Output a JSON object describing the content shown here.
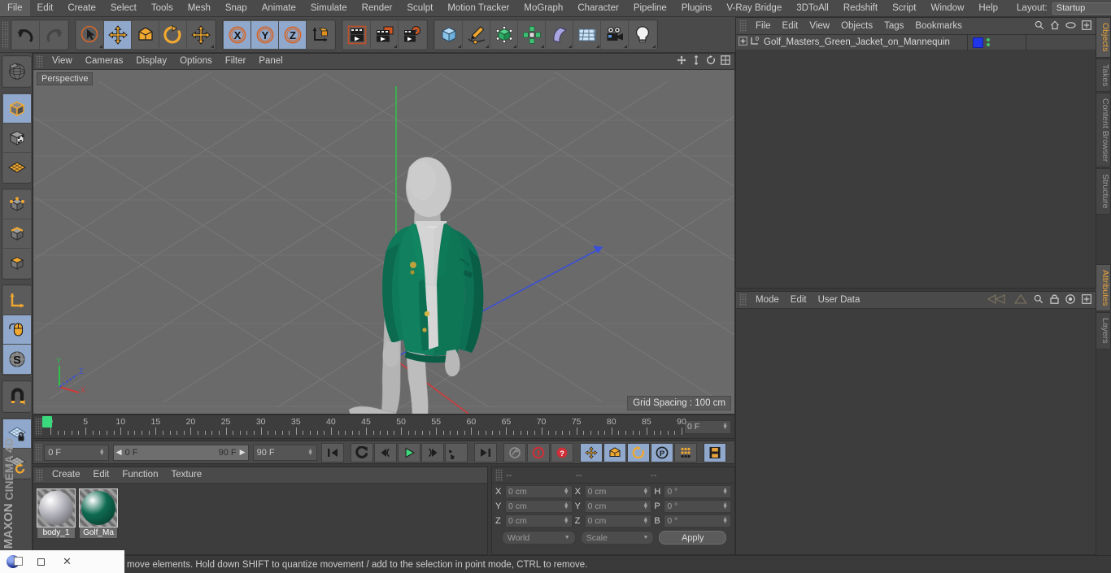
{
  "menubar": {
    "items": [
      "File",
      "Edit",
      "Create",
      "Select",
      "Tools",
      "Mesh",
      "Snap",
      "Animate",
      "Simulate",
      "Render",
      "Sculpt",
      "Motion Tracker",
      "MoGraph",
      "Character",
      "Pipeline",
      "Plugins",
      "V-Ray Bridge",
      "3DToAll",
      "Redshift",
      "Script",
      "Window",
      "Help"
    ],
    "layout_label": "Layout:",
    "layout_value": "Startup",
    "search_icon": "search-icon"
  },
  "toolbar": {
    "groups": [
      {
        "name": "history",
        "buttons": [
          {
            "name": "undo-button",
            "icon": "undo-icon",
            "active": false
          },
          {
            "name": "redo-button",
            "icon": "redo-icon",
            "active": false
          }
        ]
      },
      {
        "name": "transform-tools",
        "buttons": [
          {
            "name": "live-selection-tool",
            "icon": "cursor-circle-icon",
            "active": false
          },
          {
            "name": "move-tool",
            "icon": "move-arrows-icon",
            "active": true
          },
          {
            "name": "scale-tool",
            "icon": "scale-box-icon",
            "active": false
          },
          {
            "name": "rotate-tool",
            "icon": "rotate-arc-icon",
            "active": false
          },
          {
            "name": "transform-tool",
            "icon": "move-arrows-icon",
            "active": false
          }
        ]
      },
      {
        "name": "axis-locks",
        "buttons": [
          {
            "name": "lock-x-axis-button",
            "icon": "x-axis-icon",
            "active": true
          },
          {
            "name": "lock-y-axis-button",
            "icon": "y-axis-icon",
            "active": true
          },
          {
            "name": "lock-z-axis-button",
            "icon": "z-axis-icon",
            "active": true
          },
          {
            "name": "world-object-coord-button",
            "icon": "world-axis-icon",
            "active": false
          }
        ]
      },
      {
        "name": "render-tools",
        "buttons": [
          {
            "name": "render-view-button",
            "icon": "render-view-icon",
            "active": false
          },
          {
            "name": "render-to-picture-viewer-button",
            "icon": "render-picture-icon",
            "active": false
          },
          {
            "name": "render-settings-button",
            "icon": "render-settings-icon",
            "active": false
          }
        ]
      },
      {
        "name": "create-objects",
        "buttons": [
          {
            "name": "add-cube-button",
            "icon": "cube-icon",
            "active": false
          },
          {
            "name": "add-spline-button",
            "icon": "pen-spline-icon",
            "active": false
          },
          {
            "name": "add-generator-button",
            "icon": "generator-icon",
            "active": false
          },
          {
            "name": "add-mograph-button",
            "icon": "mograph-cluster-icon",
            "active": false
          },
          {
            "name": "add-deformer-button",
            "icon": "bend-deformer-icon",
            "active": false
          },
          {
            "name": "add-scene-object-button",
            "icon": "floor-grid-icon",
            "active": false
          },
          {
            "name": "add-camera-button",
            "icon": "camera-icon",
            "active": false
          },
          {
            "name": "add-light-button",
            "icon": "light-bulb-icon",
            "active": false
          }
        ]
      }
    ]
  },
  "left_toolbar": {
    "items": [
      {
        "name": "make-editable-button",
        "icon": "sphere-wire-icon",
        "active": false
      },
      {
        "name": "model-mode-button",
        "icon": "model-cube-icon",
        "active": true
      },
      {
        "name": "texture-mode-button",
        "icon": "texture-cube-icon",
        "active": false
      },
      {
        "name": "uv-mesh-mode-button",
        "icon": "uv-mesh-icon",
        "active": false
      },
      {
        "name": "points-mode-button",
        "icon": "points-cube-icon",
        "active": false
      },
      {
        "name": "edges-mode-button",
        "icon": "edges-cube-icon",
        "active": false
      },
      {
        "name": "polygons-mode-button",
        "icon": "polygons-cube-icon",
        "active": false
      },
      {
        "name": "object-axis-mode-button",
        "icon": "axis-icon",
        "active": false
      },
      {
        "name": "viewport-solo-mode-button",
        "icon": "mouse-icon",
        "active": true
      },
      {
        "name": "workplane-mode-button",
        "icon": "s-disc-icon",
        "active": true
      },
      {
        "name": "enable-snap-button",
        "icon": "magnet-icon",
        "active": false
      },
      {
        "name": "lock-workplane-button",
        "icon": "workplane-lock-icon",
        "active": true
      },
      {
        "name": "planar-workplane-button",
        "icon": "workplane-rotate-icon",
        "active": false
      }
    ],
    "brand_top": "MAXON",
    "brand_bottom": "CINEMA 4D"
  },
  "viewport": {
    "menu": [
      "View",
      "Cameras",
      "Display",
      "Options",
      "Filter",
      "Panel"
    ],
    "label": "Perspective",
    "grid_badge": "Grid Spacing : 100 cm",
    "axis_gizmo": {
      "x": "X",
      "y": "Y",
      "z": "Z",
      "x_color": "#e04040",
      "y_color": "#3ccb4a",
      "z_color": "#4060e0"
    },
    "right_icons": [
      "move-view-icon",
      "scale-view-icon",
      "rotate-view-icon",
      "maximize-view-icon"
    ],
    "jacket_color": "#0f7a5a",
    "mannequin_color": "#b9b9b9",
    "background_color": "#6a6a6a"
  },
  "timeline": {
    "ticks": [
      0,
      5,
      10,
      15,
      20,
      25,
      30,
      35,
      40,
      45,
      50,
      55,
      60,
      65,
      70,
      75,
      80,
      85,
      90
    ],
    "start": 0,
    "end": 90,
    "playhead_frame": 0,
    "frame_field": "0 F"
  },
  "transport": {
    "current_frame": "0 F",
    "range_start": "0 F",
    "range_end": "90 F",
    "end_frame": "90 F",
    "buttons": [
      {
        "name": "go-to-start-button",
        "icon": "skip-start-icon",
        "active": false
      },
      {
        "name": "step-back-keyframe-button",
        "icon": "prev-key-icon",
        "active": false
      },
      {
        "name": "play-reverse-button",
        "icon": "play-reverse-icon",
        "active": false
      },
      {
        "name": "play-button",
        "icon": "play-icon",
        "active": false
      },
      {
        "name": "step-forward-keyframe-button",
        "icon": "next-key-icon",
        "active": false
      },
      {
        "name": "loop-button",
        "icon": "loop-icon",
        "active": false
      },
      {
        "name": "go-to-end-button",
        "icon": "skip-end-icon",
        "active": false
      },
      {
        "name": "record-active-objects-button",
        "icon": "record-key-icon",
        "active": false
      },
      {
        "name": "autokeying-button",
        "icon": "autokey-icon",
        "active": false
      },
      {
        "name": "keyframe-selection-button",
        "icon": "keyframe-question-icon",
        "active": false
      },
      {
        "name": "position-key-button",
        "icon": "position-key-icon",
        "active": true
      },
      {
        "name": "scale-key-button",
        "icon": "scale-key-icon",
        "active": true
      },
      {
        "name": "rotation-key-button",
        "icon": "rotation-key-icon",
        "active": true
      },
      {
        "name": "param-key-button",
        "icon": "param-key-icon",
        "active": true
      },
      {
        "name": "point-level-animation-button",
        "icon": "pla-dots-icon",
        "active": false
      },
      {
        "name": "timeline-view-button",
        "icon": "filmstrip-icon",
        "active": true
      }
    ]
  },
  "materials": {
    "menu": [
      "Create",
      "Edit",
      "Function",
      "Texture"
    ],
    "items": [
      {
        "name": "body_1",
        "color": "#b4b4bc",
        "selected": true
      },
      {
        "name": "Golf_Ma",
        "color": "#0e6b51",
        "selected": true
      }
    ]
  },
  "coordinates": {
    "headers": [
      "--",
      "--",
      "--"
    ],
    "position": {
      "label_x": "X",
      "label_y": "Y",
      "label_z": "Z",
      "x": "0 cm",
      "y": "0 cm",
      "z": "0 cm"
    },
    "size": {
      "label_x": "X",
      "label_y": "Y",
      "label_z": "Z",
      "x": "0 cm",
      "y": "0 cm",
      "z": "0 cm"
    },
    "rotation": {
      "label_h": "H",
      "label_p": "P",
      "label_b": "B",
      "h": "0 °",
      "p": "0 °",
      "b": "0 °"
    },
    "coord_system": "World",
    "size_mode": "Scale",
    "apply_label": "Apply"
  },
  "object_manager": {
    "menu": [
      "File",
      "Edit",
      "View",
      "Objects",
      "Tags",
      "Bookmarks"
    ],
    "icons": [
      "search-icon",
      "home-icon",
      "eye-icon",
      "fullscreen-icon"
    ],
    "rows": [
      {
        "name": "Golf_Masters_Green_Jacket_on_Mannequin",
        "tag_color": "#2036e8",
        "expandable": true,
        "layer_badge": "0"
      }
    ]
  },
  "attributes": {
    "menu": [
      "Mode",
      "Edit",
      "User Data"
    ],
    "icons": [
      "nav-back-icon",
      "nav-forward-icon",
      "search-icon",
      "lock-icon",
      "target-icon",
      "fullscreen-icon"
    ]
  },
  "dock_tabs": {
    "top": [
      {
        "label": "Objects",
        "active": true
      },
      {
        "label": "Takes",
        "active": false
      },
      {
        "label": "Content Browser",
        "active": false
      },
      {
        "label": "Structure",
        "active": false
      }
    ],
    "bottom": [
      {
        "label": "Attributes",
        "active": true
      },
      {
        "label": "Layers",
        "active": false
      }
    ]
  },
  "statusbar": {
    "message": "move elements. Hold down SHIFT to quantize movement / add to the selection in point mode, CTRL to remove."
  },
  "window_chrome": {
    "minimize": "—",
    "maximize": "□",
    "close": "✕"
  }
}
